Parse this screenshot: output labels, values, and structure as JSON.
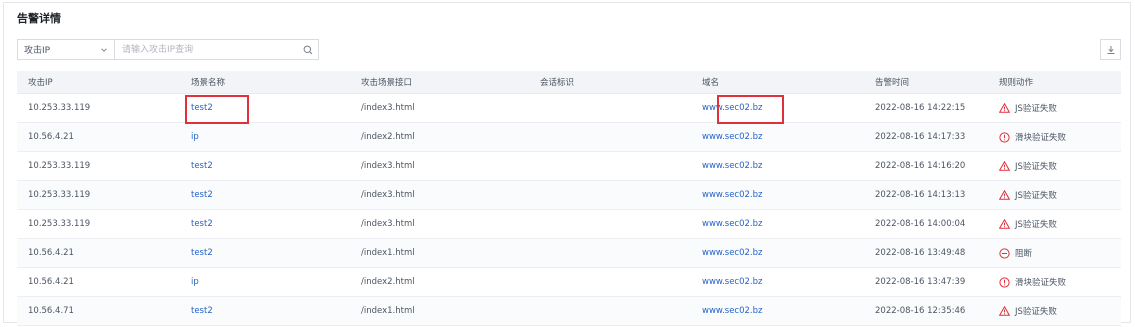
{
  "panel": {
    "title": "告警详情"
  },
  "filter": {
    "select_value": "攻击IP",
    "placeholder": "请输入攻击IP查询"
  },
  "columns": [
    "攻击IP",
    "场景名称",
    "攻击场景接口",
    "会话标识",
    "域名",
    "告警时间",
    "规则动作"
  ],
  "rows": [
    {
      "ip": "10.253.33.119",
      "scene": "test2",
      "api": "/index3.html",
      "session": "",
      "domain": "www.sec02.bz",
      "time": "2022-08-16 14:22:15",
      "action": "JS验证失败",
      "action_type": "warn"
    },
    {
      "ip": "10.56.4.21",
      "scene": "ip",
      "api": "/index2.html",
      "session": "",
      "domain": "www.sec02.bz",
      "time": "2022-08-16 14:17:33",
      "action": "滑块验证失败",
      "action_type": "info"
    },
    {
      "ip": "10.253.33.119",
      "scene": "test2",
      "api": "/index3.html",
      "session": "",
      "domain": "www.sec02.bz",
      "time": "2022-08-16 14:16:20",
      "action": "JS验证失败",
      "action_type": "warn"
    },
    {
      "ip": "10.253.33.119",
      "scene": "test2",
      "api": "/index3.html",
      "session": "",
      "domain": "www.sec02.bz",
      "time": "2022-08-16 14:13:13",
      "action": "JS验证失败",
      "action_type": "warn"
    },
    {
      "ip": "10.253.33.119",
      "scene": "test2",
      "api": "/index3.html",
      "session": "",
      "domain": "www.sec02.bz",
      "time": "2022-08-16 14:00:04",
      "action": "JS验证失败",
      "action_type": "warn"
    },
    {
      "ip": "10.56.4.21",
      "scene": "test2",
      "api": "/index1.html",
      "session": "",
      "domain": "www.sec02.bz",
      "time": "2022-08-16 13:49:48",
      "action": "阻断",
      "action_type": "block"
    },
    {
      "ip": "10.56.4.21",
      "scene": "ip",
      "api": "/index2.html",
      "session": "",
      "domain": "www.sec02.bz",
      "time": "2022-08-16 13:47:39",
      "action": "滑块验证失败",
      "action_type": "info"
    },
    {
      "ip": "10.56.4.71",
      "scene": "test2",
      "api": "/index1.html",
      "session": "",
      "domain": "www.sec02.bz",
      "time": "2022-08-16 12:35:46",
      "action": "JS验证失败",
      "action_type": "warn"
    }
  ],
  "icons": {
    "select": "chevron-down-icon",
    "search": "search-icon",
    "download": "download-icon",
    "warn": "warning-triangle-icon",
    "info": "alert-circle-icon",
    "block": "block-circle-icon"
  },
  "colors": {
    "link": "#2563c9",
    "alert": "#e0303b",
    "highlight": "#e0303b"
  }
}
